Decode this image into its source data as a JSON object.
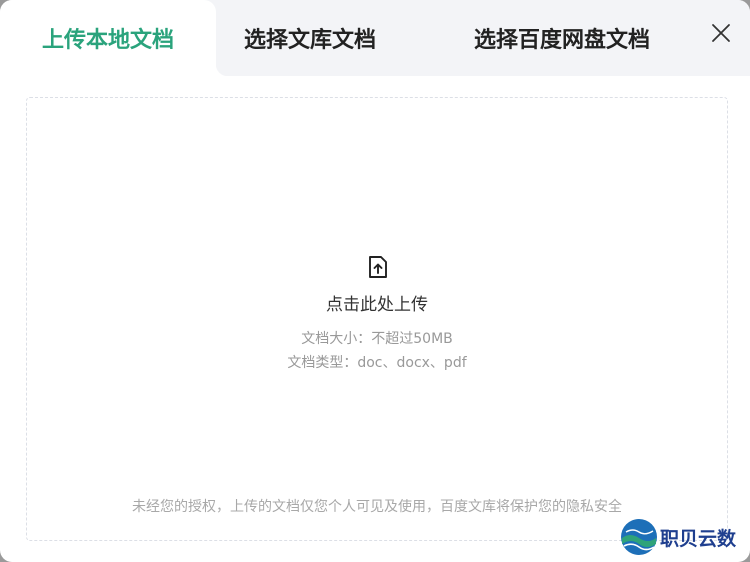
{
  "tabs": [
    {
      "label": "上传本地文档",
      "active": true
    },
    {
      "label": "选择文库文档",
      "active": false
    },
    {
      "label": "选择百度网盘文档",
      "active": false
    }
  ],
  "close_icon": "close-icon",
  "upload": {
    "icon": "file-upload-icon",
    "title": "点击此处上传",
    "size_hint": "文档大小：不超过50MB",
    "type_hint": "文档类型：doc、docx、pdf"
  },
  "privacy_note": "未经您的授权，上传的文档仅您个人可见及使用，百度文库将保护您的隐私安全",
  "watermark": {
    "text": "职贝云数"
  },
  "colors": {
    "accent": "#2aa37c",
    "tab_bar_bg": "#f3f4f7",
    "hint_text": "#999999",
    "watermark_text": "#1f3f8f"
  }
}
